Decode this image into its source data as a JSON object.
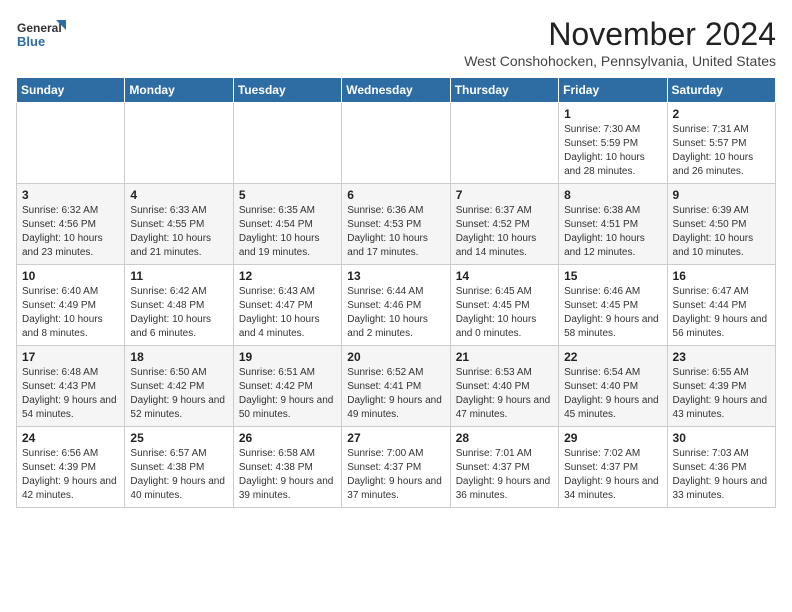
{
  "header": {
    "logo": {
      "line1": "General",
      "line2": "Blue"
    },
    "title": "November 2024",
    "subtitle": "West Conshohocken, Pennsylvania, United States"
  },
  "days_of_week": [
    "Sunday",
    "Monday",
    "Tuesday",
    "Wednesday",
    "Thursday",
    "Friday",
    "Saturday"
  ],
  "weeks": [
    [
      {
        "day": "",
        "info": ""
      },
      {
        "day": "",
        "info": ""
      },
      {
        "day": "",
        "info": ""
      },
      {
        "day": "",
        "info": ""
      },
      {
        "day": "",
        "info": ""
      },
      {
        "day": "1",
        "info": "Sunrise: 7:30 AM\nSunset: 5:59 PM\nDaylight: 10 hours and 28 minutes."
      },
      {
        "day": "2",
        "info": "Sunrise: 7:31 AM\nSunset: 5:57 PM\nDaylight: 10 hours and 26 minutes."
      }
    ],
    [
      {
        "day": "3",
        "info": "Sunrise: 6:32 AM\nSunset: 4:56 PM\nDaylight: 10 hours and 23 minutes."
      },
      {
        "day": "4",
        "info": "Sunrise: 6:33 AM\nSunset: 4:55 PM\nDaylight: 10 hours and 21 minutes."
      },
      {
        "day": "5",
        "info": "Sunrise: 6:35 AM\nSunset: 4:54 PM\nDaylight: 10 hours and 19 minutes."
      },
      {
        "day": "6",
        "info": "Sunrise: 6:36 AM\nSunset: 4:53 PM\nDaylight: 10 hours and 17 minutes."
      },
      {
        "day": "7",
        "info": "Sunrise: 6:37 AM\nSunset: 4:52 PM\nDaylight: 10 hours and 14 minutes."
      },
      {
        "day": "8",
        "info": "Sunrise: 6:38 AM\nSunset: 4:51 PM\nDaylight: 10 hours and 12 minutes."
      },
      {
        "day": "9",
        "info": "Sunrise: 6:39 AM\nSunset: 4:50 PM\nDaylight: 10 hours and 10 minutes."
      }
    ],
    [
      {
        "day": "10",
        "info": "Sunrise: 6:40 AM\nSunset: 4:49 PM\nDaylight: 10 hours and 8 minutes."
      },
      {
        "day": "11",
        "info": "Sunrise: 6:42 AM\nSunset: 4:48 PM\nDaylight: 10 hours and 6 minutes."
      },
      {
        "day": "12",
        "info": "Sunrise: 6:43 AM\nSunset: 4:47 PM\nDaylight: 10 hours and 4 minutes."
      },
      {
        "day": "13",
        "info": "Sunrise: 6:44 AM\nSunset: 4:46 PM\nDaylight: 10 hours and 2 minutes."
      },
      {
        "day": "14",
        "info": "Sunrise: 6:45 AM\nSunset: 4:45 PM\nDaylight: 10 hours and 0 minutes."
      },
      {
        "day": "15",
        "info": "Sunrise: 6:46 AM\nSunset: 4:45 PM\nDaylight: 9 hours and 58 minutes."
      },
      {
        "day": "16",
        "info": "Sunrise: 6:47 AM\nSunset: 4:44 PM\nDaylight: 9 hours and 56 minutes."
      }
    ],
    [
      {
        "day": "17",
        "info": "Sunrise: 6:48 AM\nSunset: 4:43 PM\nDaylight: 9 hours and 54 minutes."
      },
      {
        "day": "18",
        "info": "Sunrise: 6:50 AM\nSunset: 4:42 PM\nDaylight: 9 hours and 52 minutes."
      },
      {
        "day": "19",
        "info": "Sunrise: 6:51 AM\nSunset: 4:42 PM\nDaylight: 9 hours and 50 minutes."
      },
      {
        "day": "20",
        "info": "Sunrise: 6:52 AM\nSunset: 4:41 PM\nDaylight: 9 hours and 49 minutes."
      },
      {
        "day": "21",
        "info": "Sunrise: 6:53 AM\nSunset: 4:40 PM\nDaylight: 9 hours and 47 minutes."
      },
      {
        "day": "22",
        "info": "Sunrise: 6:54 AM\nSunset: 4:40 PM\nDaylight: 9 hours and 45 minutes."
      },
      {
        "day": "23",
        "info": "Sunrise: 6:55 AM\nSunset: 4:39 PM\nDaylight: 9 hours and 43 minutes."
      }
    ],
    [
      {
        "day": "24",
        "info": "Sunrise: 6:56 AM\nSunset: 4:39 PM\nDaylight: 9 hours and 42 minutes."
      },
      {
        "day": "25",
        "info": "Sunrise: 6:57 AM\nSunset: 4:38 PM\nDaylight: 9 hours and 40 minutes."
      },
      {
        "day": "26",
        "info": "Sunrise: 6:58 AM\nSunset: 4:38 PM\nDaylight: 9 hours and 39 minutes."
      },
      {
        "day": "27",
        "info": "Sunrise: 7:00 AM\nSunset: 4:37 PM\nDaylight: 9 hours and 37 minutes."
      },
      {
        "day": "28",
        "info": "Sunrise: 7:01 AM\nSunset: 4:37 PM\nDaylight: 9 hours and 36 minutes."
      },
      {
        "day": "29",
        "info": "Sunrise: 7:02 AM\nSunset: 4:37 PM\nDaylight: 9 hours and 34 minutes."
      },
      {
        "day": "30",
        "info": "Sunrise: 7:03 AM\nSunset: 4:36 PM\nDaylight: 9 hours and 33 minutes."
      }
    ]
  ]
}
